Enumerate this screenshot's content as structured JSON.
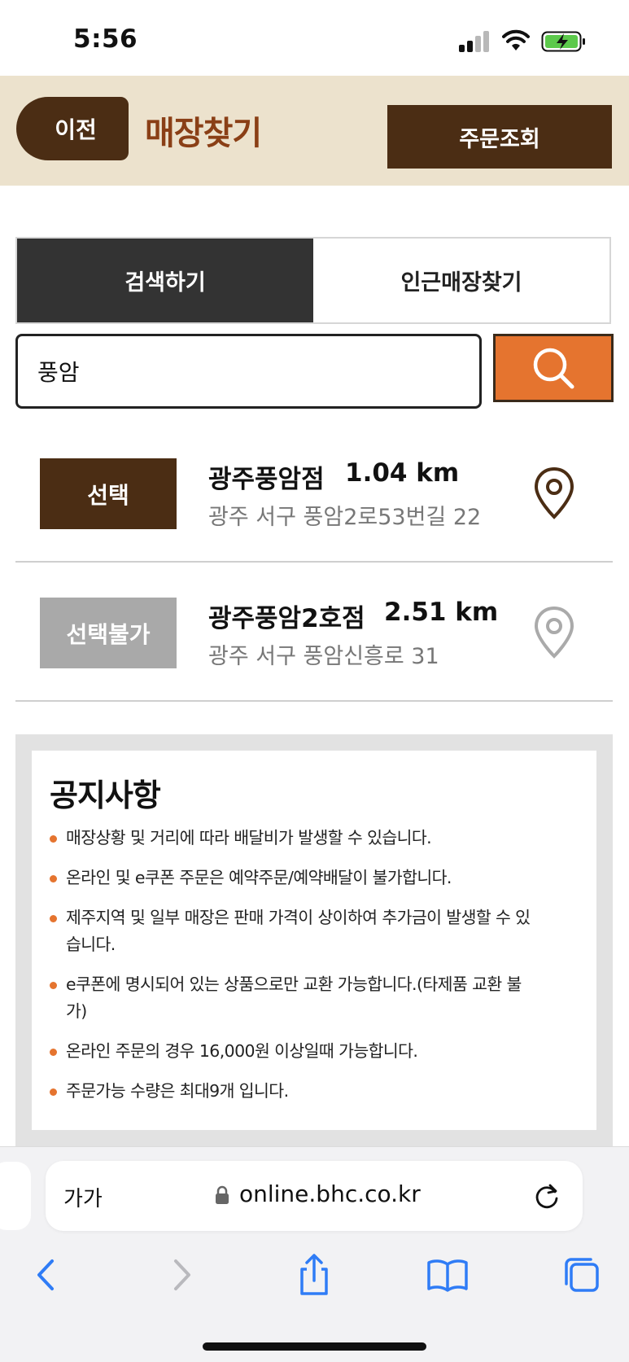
{
  "status_bar": {
    "time": "5:56"
  },
  "header": {
    "prev_label": "이전",
    "title": "매장찾기",
    "order_lookup_label": "주문조회"
  },
  "tabs": [
    {
      "label": "검색하기",
      "active": true
    },
    {
      "label": "인근매장찾기",
      "active": false
    }
  ],
  "search": {
    "value": "풍암"
  },
  "stores": [
    {
      "button_label": "선택",
      "selectable": true,
      "name": "광주풍암점",
      "distance": "1.04 km",
      "address": "광주 서구 풍암2로53번길 22"
    },
    {
      "button_label": "선택불가",
      "selectable": false,
      "name": "광주풍암2호점",
      "distance": "2.51 km",
      "address": "광주 서구 풍암신흥로 31"
    }
  ],
  "notice": {
    "title": "공지사항",
    "items": [
      "매장상황 및 거리에 따라 배달비가 발생할 수 있습니다.",
      "온라인 및 e쿠폰 주문은 예약주문/예약배달이 불가합니다.",
      "제주지역 및 일부 매장은 판매 가격이 상이하여 추가금이 발생할 수 있습니다.",
      "e쿠폰에 명시되어 있는 상품으로만 교환 가능합니다.(타제품 교환 불가)",
      "온라인 주문의 경우 16,000원 이상일때 가능합니다.",
      "주문가능 수량은 최대9개 입니다."
    ]
  },
  "browser": {
    "text_size_label": "가가",
    "url": "online.bhc.co.kr"
  },
  "colors": {
    "brown": "#4b2d14",
    "title_brown": "#8a3f16",
    "accent_orange": "#e5742f",
    "header_bg": "#ece2cd",
    "disabled_gray": "#a9a9a9"
  },
  "icons": {
    "search": "search-icon",
    "pin": "location-pin-icon",
    "lock": "lock-icon",
    "reload": "reload-icon"
  }
}
